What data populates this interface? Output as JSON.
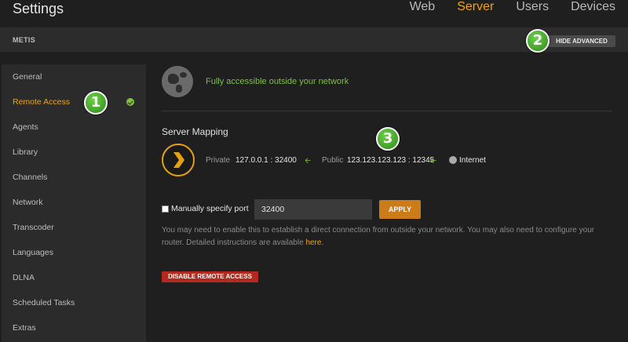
{
  "app": {
    "title": "Settings"
  },
  "topnav": {
    "items": [
      "Web",
      "Server",
      "Users",
      "Devices"
    ],
    "active": "Server"
  },
  "serverbar": {
    "server_name": "METIS",
    "hide_advanced_label": "HIDE ADVANCED"
  },
  "sidebar": {
    "items": [
      {
        "label": "General"
      },
      {
        "label": "Remote Access",
        "active": true,
        "status": "check"
      },
      {
        "label": "Agents"
      },
      {
        "label": "Library"
      },
      {
        "label": "Channels"
      },
      {
        "label": "Network"
      },
      {
        "label": "Transcoder"
      },
      {
        "label": "Languages"
      },
      {
        "label": "DLNA"
      },
      {
        "label": "Scheduled Tasks"
      },
      {
        "label": "Extras"
      }
    ]
  },
  "main": {
    "status_text": "Fully accessible outside your network",
    "mapping_title": "Server Mapping",
    "private_label": "Private",
    "private_value": "127.0.0.1 : 32400",
    "public_label": "Public",
    "public_value": "123.123.123.123 : 12345",
    "internet_label": "Internet",
    "manual_port_label": "Manually specify port",
    "manual_port_checked": false,
    "port_value": "32400",
    "apply_label": "APPLY",
    "help_text": "You may need to enable this to establish a direct connection from outside your network. You may also need to configure your router. Detailed instructions are available ",
    "help_link": "here",
    "help_end": ".",
    "disable_label": "DISABLE REMOTE ACCESS"
  },
  "callouts": [
    "1",
    "2",
    "3"
  ],
  "colors": {
    "accent": "#f0a30a",
    "success": "#7fbf3f",
    "danger": "#b3291d",
    "apply": "#cc7b19"
  }
}
